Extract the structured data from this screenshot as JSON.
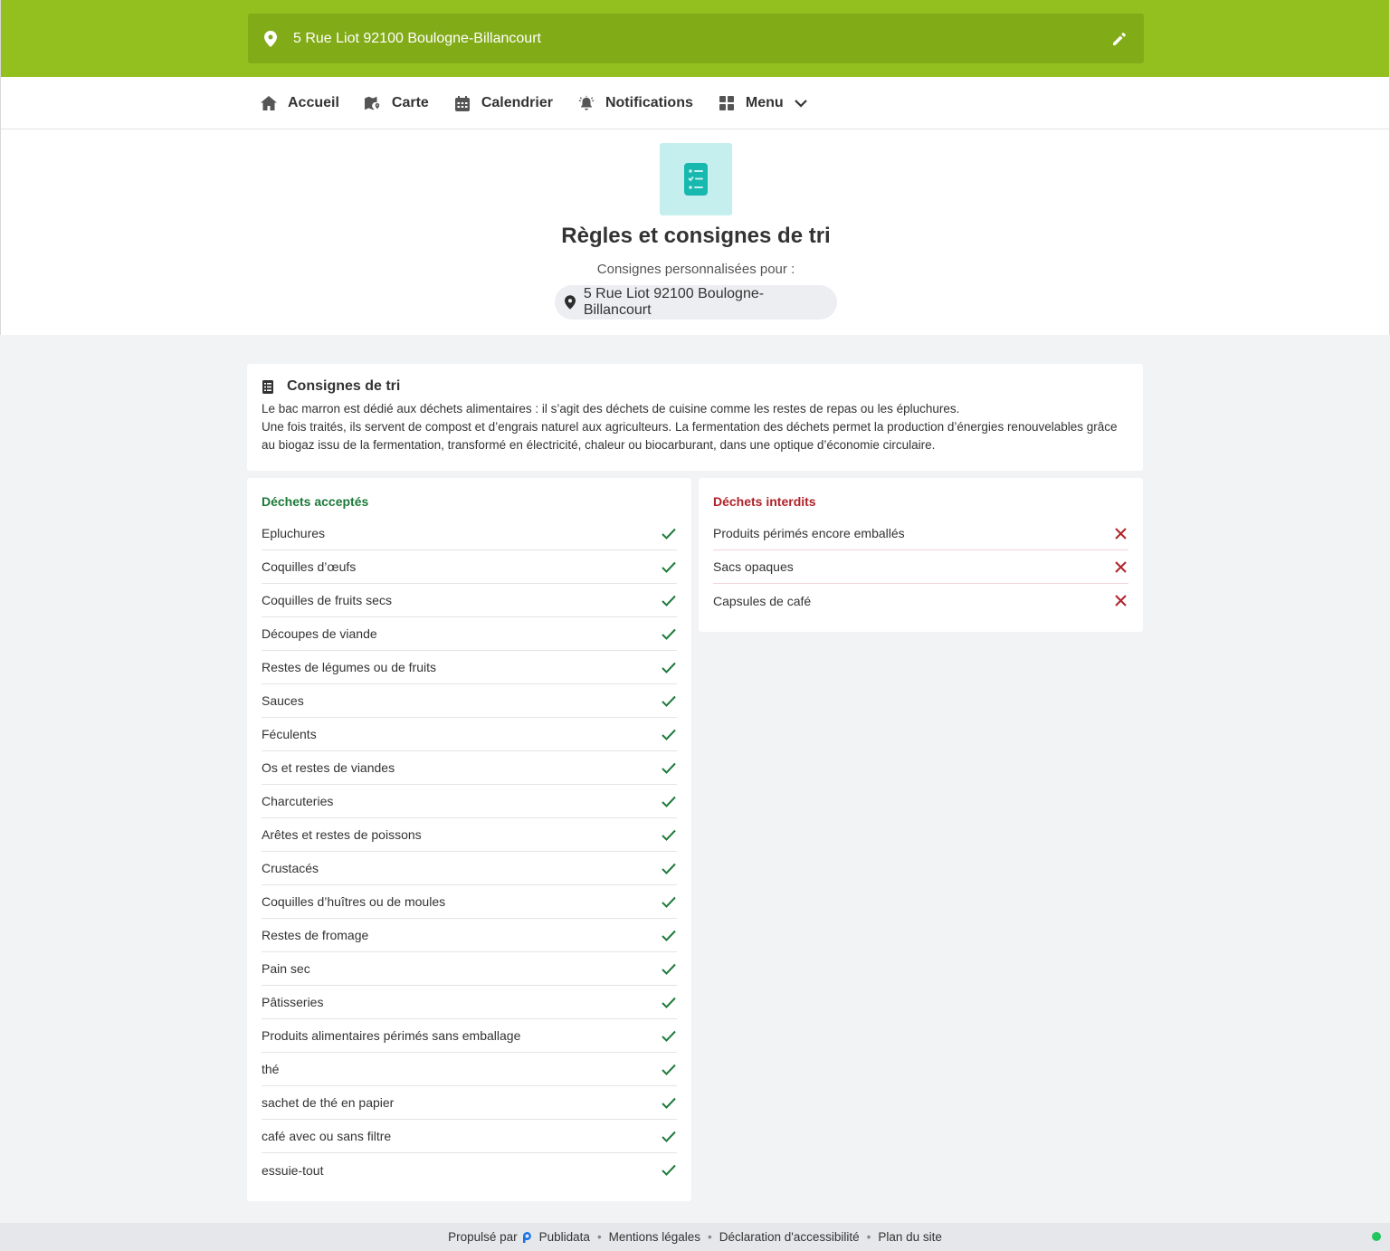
{
  "header": {
    "address": "5 Rue Liot 92100 Boulogne-Billancourt",
    "pin_icon": "map-pin-icon",
    "edit_icon": "pencil-icon",
    "brand_color": "#93c01f",
    "bar_color": "#82ab18"
  },
  "nav": {
    "items": [
      {
        "label": "Accueil",
        "icon": "home-icon"
      },
      {
        "label": "Carte",
        "icon": "map-icon"
      },
      {
        "label": "Calendrier",
        "icon": "calendar-icon"
      },
      {
        "label": "Notifications",
        "icon": "bell-icon"
      },
      {
        "label": "Menu",
        "icon": "grid-icon"
      }
    ]
  },
  "hero": {
    "icon": "checklist-icon",
    "title": "Règles et consignes de tri",
    "subtitle": "Consignes personnalisées pour :",
    "address": "5 Rue Liot 92100 Boulogne-Billancourt"
  },
  "intro": {
    "title": "Consignes de tri",
    "icon": "list-icon",
    "paragraph1": "Le bac marron est dédié aux déchets alimentaires : il s’agit des déchets de cuisine comme les restes de repas ou les épluchures.",
    "paragraph2": "Une fois traités, ils servent de compost et d’engrais naturel aux agriculteurs. La fermentation des déchets permet la production d’énergies renouvelables grâce au biogaz issu de la fermentation, transformé en électricité, chaleur ou biocarburant, dans une optique d’économie circulaire."
  },
  "accepted": {
    "title": "Déchets acceptés",
    "color": "#1d7a3a",
    "items": [
      "Epluchures",
      "Coquilles d’œufs",
      "Coquilles de fruits secs",
      "Découpes de viande",
      "Restes de légumes ou de fruits",
      "Sauces",
      "Féculents",
      "Os et restes de viandes",
      "Charcuteries",
      "Arêtes et restes de poissons",
      "Crustacés",
      "Coquilles d’huîtres ou de moules",
      "Restes de fromage",
      "Pain sec",
      "Pâtisseries",
      "Produits alimentaires périmés sans emballage",
      "thé",
      "sachet de thé en papier",
      "café avec ou sans filtre",
      "essuie-tout"
    ]
  },
  "forbidden": {
    "title": "Déchets interdits",
    "color": "#b0232a",
    "items": [
      "Produits périmés encore emballés",
      "Sacs opaques",
      "Capsules de café"
    ]
  },
  "footer": {
    "powered_by": "Propulsé par",
    "brand": "Publidata",
    "links": [
      "Mentions légales",
      "Déclaration d'accessibilité",
      "Plan du site"
    ]
  }
}
